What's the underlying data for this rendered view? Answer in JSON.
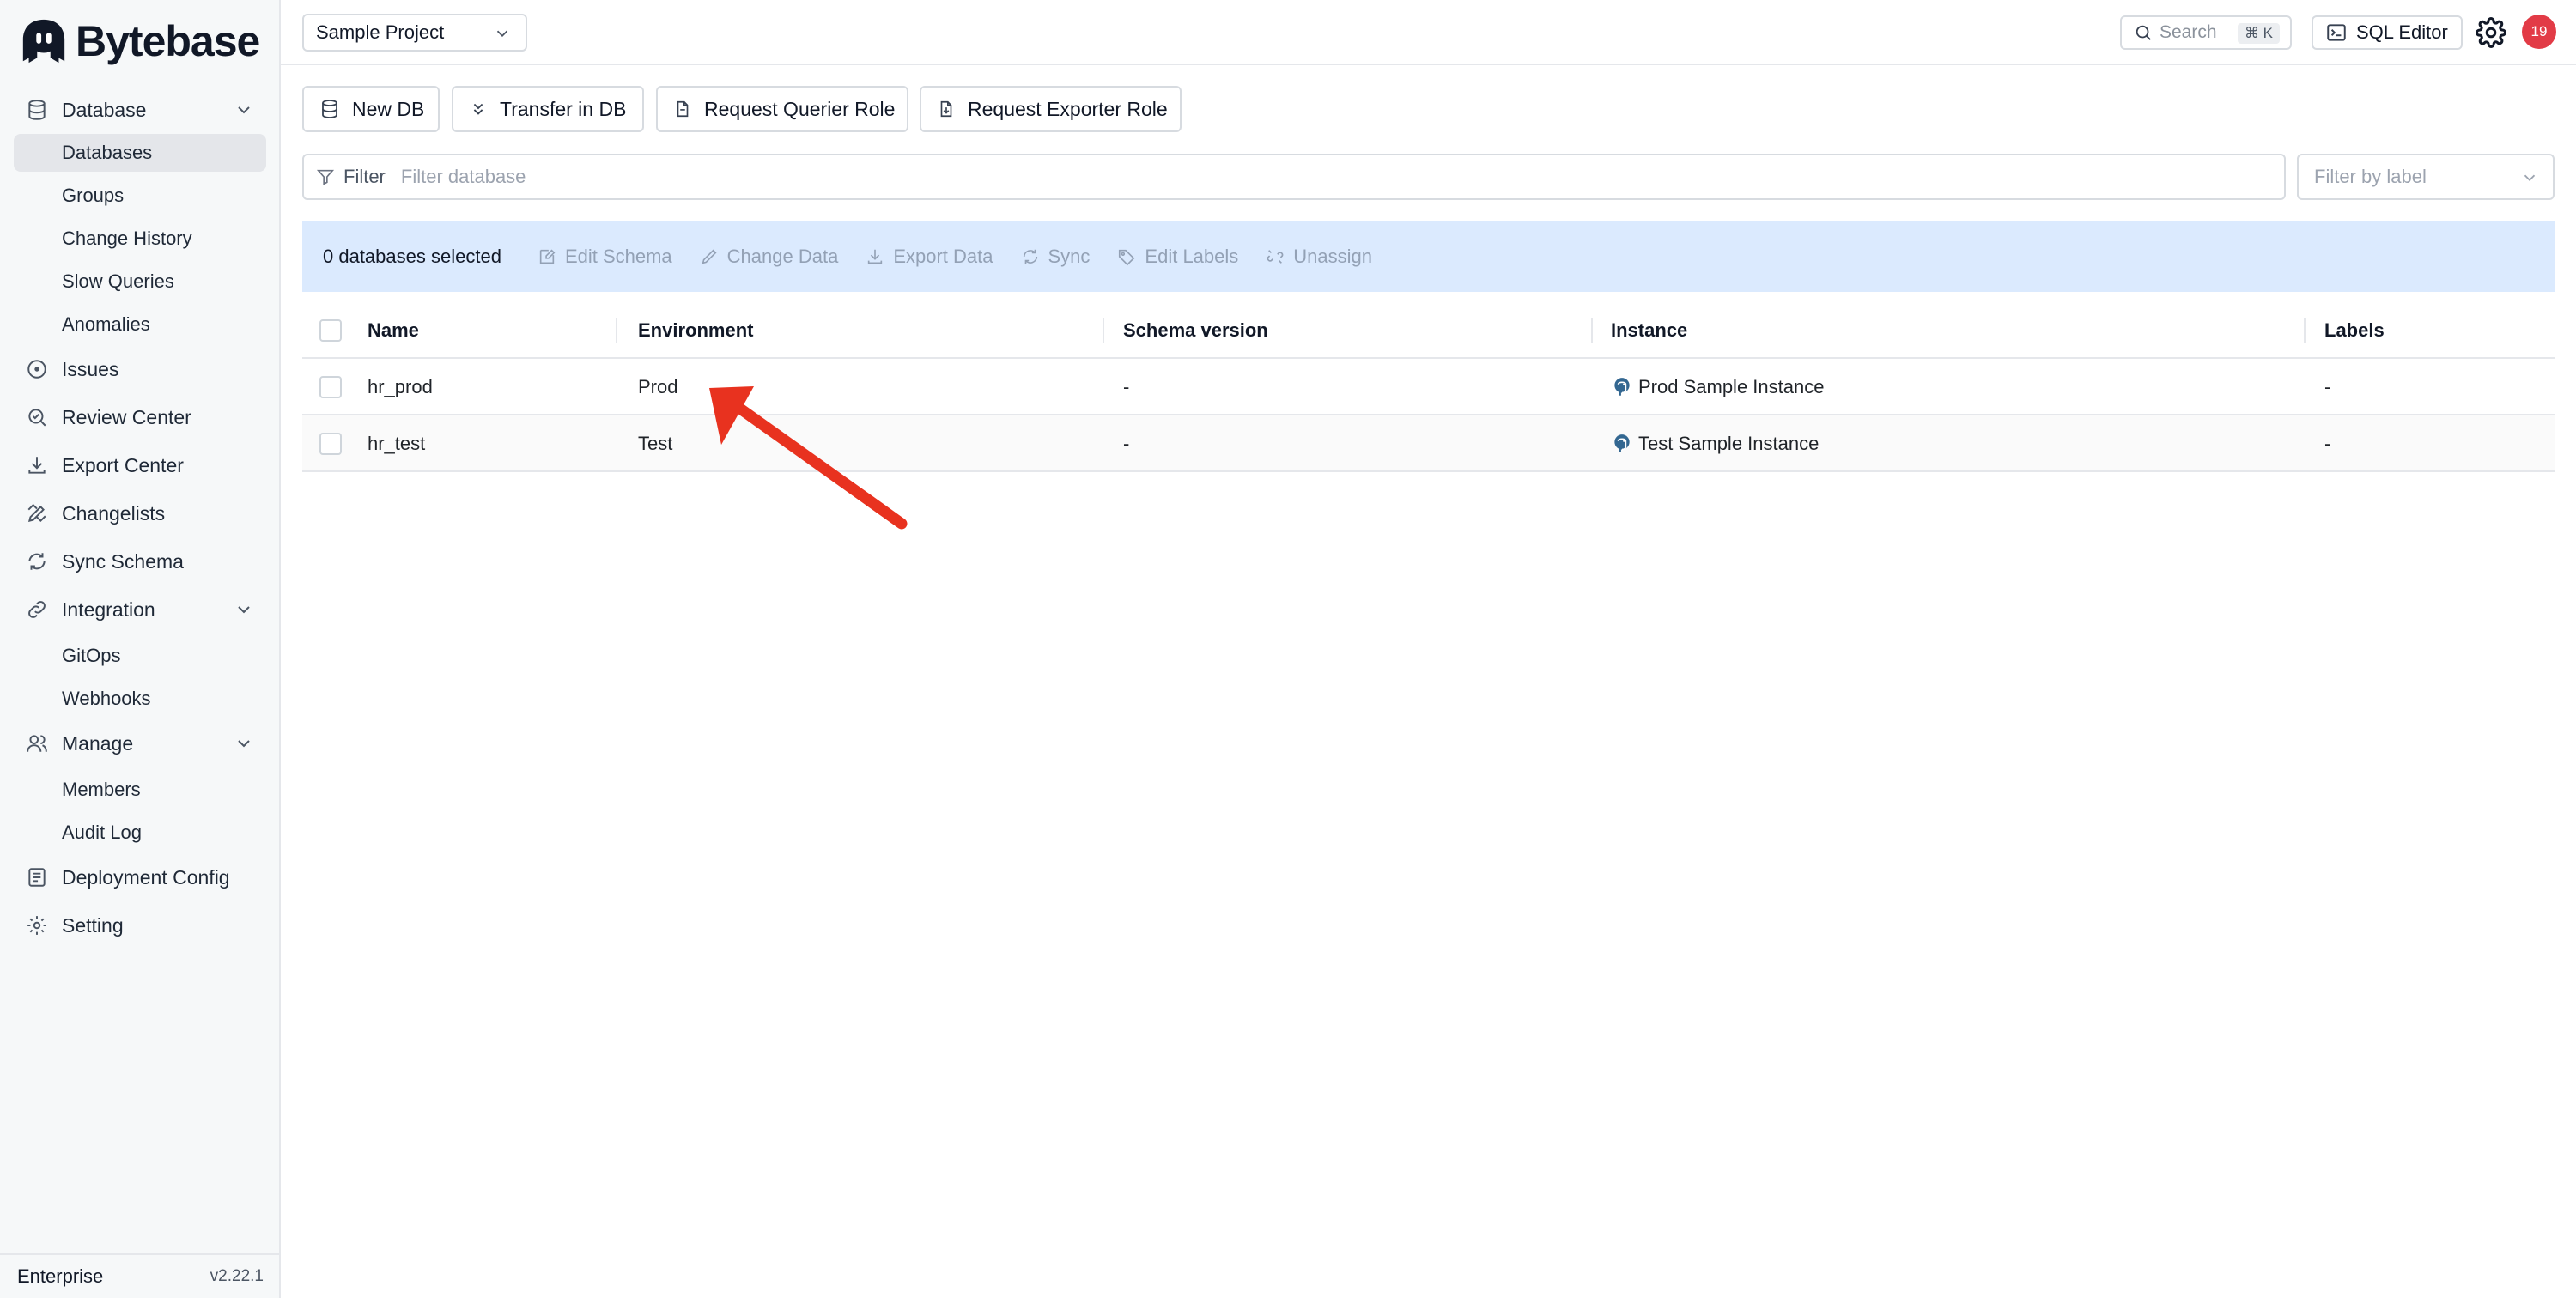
{
  "app": {
    "brand": "Bytebase"
  },
  "sidebar": {
    "sections": {
      "database": {
        "label": "Database"
      },
      "issues": {
        "label": "Issues"
      },
      "review_center": {
        "label": "Review Center"
      },
      "export_center": {
        "label": "Export Center"
      },
      "changelists": {
        "label": "Changelists"
      },
      "sync_schema": {
        "label": "Sync Schema"
      },
      "integration": {
        "label": "Integration"
      },
      "manage": {
        "label": "Manage"
      },
      "deployment_config": {
        "label": "Deployment Config"
      },
      "setting": {
        "label": "Setting"
      }
    },
    "database_items": [
      "Databases",
      "Groups",
      "Change History",
      "Slow Queries",
      "Anomalies"
    ],
    "integration_items": [
      "GitOps",
      "Webhooks"
    ],
    "manage_items": [
      "Members",
      "Audit Log"
    ],
    "active_item": "Databases",
    "footer": {
      "plan": "Enterprise",
      "version": "v2.22.1"
    }
  },
  "topbar": {
    "project": "Sample Project",
    "search_placeholder": "Search",
    "search_shortcut": "⌘ K",
    "sql_editor_label": "SQL Editor",
    "notification_count": "19"
  },
  "actions": {
    "new_db": "New DB",
    "transfer_in_db": "Transfer in DB",
    "request_querier_role": "Request Querier Role",
    "request_exporter_role": "Request Exporter Role"
  },
  "filter": {
    "label": "Filter",
    "placeholder": "Filter database",
    "label_filter_placeholder": "Filter by label"
  },
  "bulk": {
    "selected_text": "0 databases selected",
    "actions": [
      "Edit Schema",
      "Change Data",
      "Export Data",
      "Sync",
      "Edit Labels",
      "Unassign"
    ]
  },
  "table": {
    "columns": [
      "Name",
      "Environment",
      "Schema version",
      "Instance",
      "Labels"
    ],
    "rows": [
      {
        "name": "hr_prod",
        "environment": "Prod",
        "schema_version": "-",
        "instance": "Prod Sample Instance",
        "labels": "-"
      },
      {
        "name": "hr_test",
        "environment": "Test",
        "schema_version": "-",
        "instance": "Test Sample Instance",
        "labels": "-"
      }
    ]
  },
  "colors": {
    "accent_bulk_bar": "#dbeafe",
    "notification_badge": "#e23b46",
    "annotation_arrow": "#e8321f",
    "sidebar_bg": "#f6f8f9"
  }
}
